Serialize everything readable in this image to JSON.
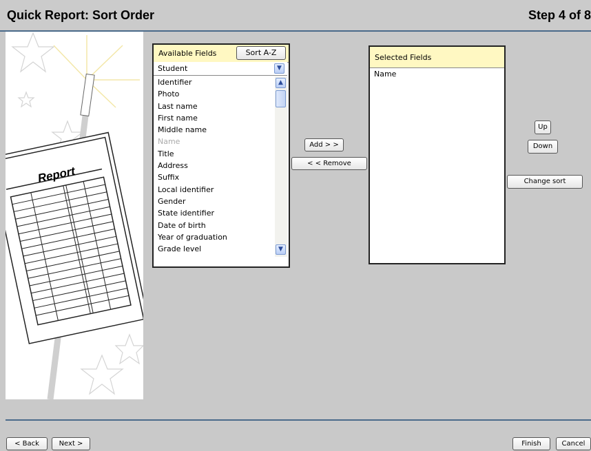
{
  "window": {
    "title": "Quick Report: Sort Order",
    "step": "Step 4 of 8"
  },
  "illustration": {
    "report_label": "Report"
  },
  "available": {
    "header": "Available Fields",
    "sort_button": "Sort A-Z",
    "table_select": "Student",
    "fields": [
      {
        "label": "Identifier",
        "disabled": false
      },
      {
        "label": "Photo",
        "disabled": false
      },
      {
        "label": "Last name",
        "disabled": false
      },
      {
        "label": "First name",
        "disabled": false
      },
      {
        "label": "Middle name",
        "disabled": false
      },
      {
        "label": "Name",
        "disabled": true
      },
      {
        "label": "Title",
        "disabled": false
      },
      {
        "label": "Address",
        "disabled": false
      },
      {
        "label": "Suffix",
        "disabled": false
      },
      {
        "label": "Local identifier",
        "disabled": false
      },
      {
        "label": "Gender",
        "disabled": false
      },
      {
        "label": "State identifier",
        "disabled": false
      },
      {
        "label": "Date of birth",
        "disabled": false
      },
      {
        "label": "Year of graduation",
        "disabled": false
      },
      {
        "label": "Grade level",
        "disabled": false
      }
    ]
  },
  "transfer": {
    "add": "Add > >",
    "remove": "< < Remove"
  },
  "selected": {
    "header": "Selected Fields",
    "fields": [
      "Name"
    ]
  },
  "order": {
    "up": "Up",
    "down": "Down",
    "change_sort": "Change sort"
  },
  "footer": {
    "back": "< Back",
    "next": "Next >",
    "finish": "Finish",
    "cancel": "Cancel"
  },
  "colors": {
    "header_bg": "#fff8c2",
    "rule": "#4a6a8a",
    "background": "#c9c9c9"
  }
}
